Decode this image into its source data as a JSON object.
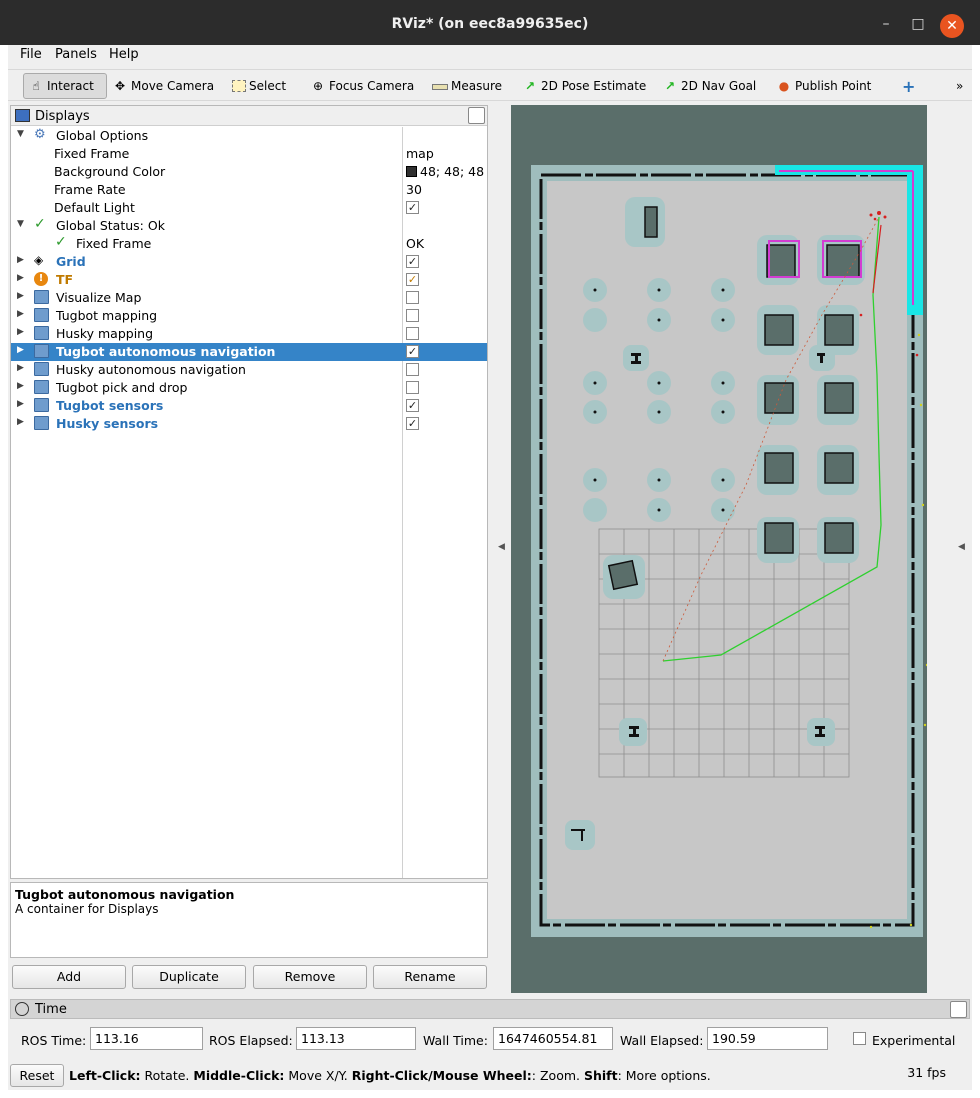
{
  "window": {
    "title": "RViz* (on eec8a99635ec)",
    "minimize": "–",
    "maximize": "□",
    "close": "✕"
  },
  "menu": [
    "File",
    "Panels",
    "Help"
  ],
  "toolbar": {
    "tools": [
      {
        "label": "Interact",
        "icon": "hand-icon"
      },
      {
        "label": "Move Camera",
        "icon": "move-camera-icon"
      },
      {
        "label": "Select",
        "icon": "select-icon"
      },
      {
        "label": "Focus Camera",
        "icon": "focus-camera-icon"
      },
      {
        "label": "Measure",
        "icon": "ruler-icon"
      },
      {
        "label": "2D Pose Estimate",
        "icon": "green-arrow-icon"
      },
      {
        "label": "2D Nav Goal",
        "icon": "green-arrow-icon"
      },
      {
        "label": "Publish Point",
        "icon": "map-pin-icon"
      }
    ],
    "add_tool": "+",
    "overflow": "»"
  },
  "displays": {
    "panel_title": "Displays",
    "global_options": {
      "label": "Global Options",
      "fixed_frame": {
        "label": "Fixed Frame",
        "value": "map"
      },
      "background_color": {
        "label": "Background Color",
        "value": "48; 48; 48",
        "swatch": "#303030"
      },
      "frame_rate": {
        "label": "Frame Rate",
        "value": "30"
      },
      "default_light": {
        "label": "Default Light",
        "checked": true
      }
    },
    "global_status": {
      "label": "Global Status: Ok",
      "fixed_frame": {
        "label": "Fixed Frame",
        "value": "OK"
      }
    },
    "items": [
      {
        "label": "Grid",
        "checked": true,
        "style": "blue"
      },
      {
        "label": "TF",
        "checked": true,
        "style": "orange"
      },
      {
        "label": "Visualize Map",
        "checked": false,
        "style": "plain"
      },
      {
        "label": "Tugbot mapping",
        "checked": false,
        "style": "plain"
      },
      {
        "label": "Husky mapping",
        "checked": false,
        "style": "plain"
      },
      {
        "label": "Tugbot autonomous navigation",
        "checked": true,
        "style": "selected"
      },
      {
        "label": "Husky autonomous navigation",
        "checked": false,
        "style": "plain"
      },
      {
        "label": "Tugbot pick and drop",
        "checked": false,
        "style": "plain"
      },
      {
        "label": "Tugbot sensors",
        "checked": true,
        "style": "blue"
      },
      {
        "label": "Husky sensors",
        "checked": true,
        "style": "blue"
      }
    ]
  },
  "description": {
    "title": "Tugbot autonomous navigation",
    "text": "A container for Displays"
  },
  "buttons": {
    "add": "Add",
    "duplicate": "Duplicate",
    "remove": "Remove",
    "rename": "Rename"
  },
  "time": {
    "panel_title": "Time",
    "ros_time": {
      "label": "ROS Time:",
      "value": "113.16"
    },
    "ros_elapsed": {
      "label": "ROS Elapsed:",
      "value": "113.13"
    },
    "wall_time": {
      "label": "Wall Time:",
      "value": "1647460554.81"
    },
    "wall_elapsed": {
      "label": "Wall Elapsed:",
      "value": "190.59"
    },
    "experimental": "Experimental"
  },
  "status": {
    "reset": "Reset",
    "left_click_key": "Left-Click:",
    "left_click_val": " Rotate. ",
    "middle_click_key": "Middle-Click:",
    "middle_click_val": " Move X/Y. ",
    "right_click_key": "Right-Click/Mouse Wheel:",
    "right_click_val": ": Zoom. ",
    "shift_key": "Shift",
    "shift_val": ": More options.",
    "fps": "31 fps"
  }
}
